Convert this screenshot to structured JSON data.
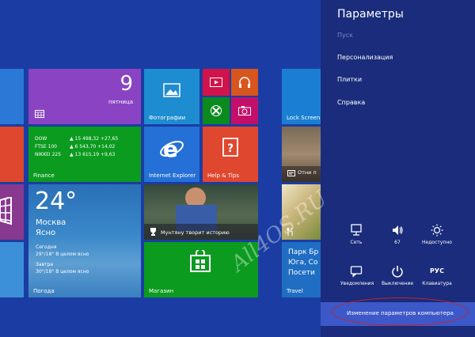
{
  "weather": {
    "temp": "24°",
    "city": "Москва",
    "condition": "Ясно",
    "today_label": "Сегодня",
    "today_forecast": "29°/18° В целом ясно",
    "tomorrow_label": "Завтра",
    "tomorrow_forecast": "30°/18° В целом ясно",
    "tile_label": "Погода"
  },
  "calendar": {
    "day_number": "9",
    "weekday": "пятница"
  },
  "finance": {
    "tile_label": "Finance",
    "rows": [
      {
        "name": "DOW",
        "value": "▲ 15 498,32 +27,65"
      },
      {
        "name": "FTSE 100",
        "value": "▲ 6 543,70 +14,02"
      },
      {
        "name": "NIKKEI 225",
        "value": "▲ 13 615,19 +9,63"
      }
    ]
  },
  "tiles": {
    "photos": "Фотографии",
    "ie": "Internet Explorer",
    "help": "Help & Tips",
    "news_caption": "Мунтяну творит историю",
    "store": "Магазин",
    "lock_screen": "Lock Screen I",
    "travel_partial": "Отни п",
    "park_partial": "Парк Бр",
    "yuga_partial": "Юга, Со",
    "visit_partial": "Посети",
    "travel": "Travel"
  },
  "charms": {
    "title": "Параметры",
    "items": [
      "Пуск",
      "Персонализация",
      "Плитки",
      "Справка"
    ],
    "quick": [
      {
        "label": "Сеть",
        "icon": "network-icon"
      },
      {
        "label": "67",
        "icon": "volume-icon"
      },
      {
        "label": "Недоступно",
        "icon": "brightness-icon"
      },
      {
        "label": "Уведомления",
        "icon": "notifications-icon"
      },
      {
        "label": "Выключение",
        "icon": "power-icon"
      },
      {
        "label": "Клавиатура",
        "icon": "keyboard-icon",
        "glyph": "РУС"
      }
    ],
    "change_pc_settings": "Изменение параметров компьютера"
  },
  "watermark": "All4OS.RU"
}
